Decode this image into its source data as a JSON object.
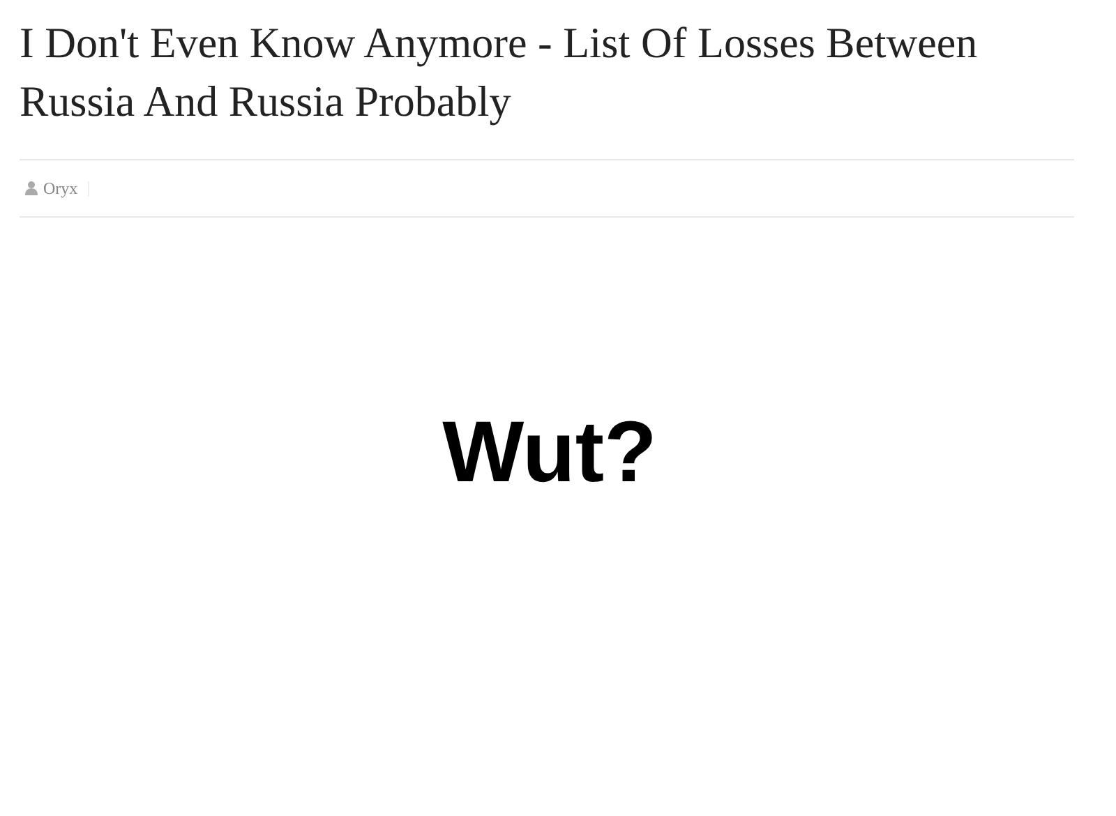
{
  "post": {
    "title": "I Don't Even Know Anymore - List Of Losses Between Russia And Russia Probably",
    "author": "Oryx",
    "body_text": "Wut?"
  }
}
